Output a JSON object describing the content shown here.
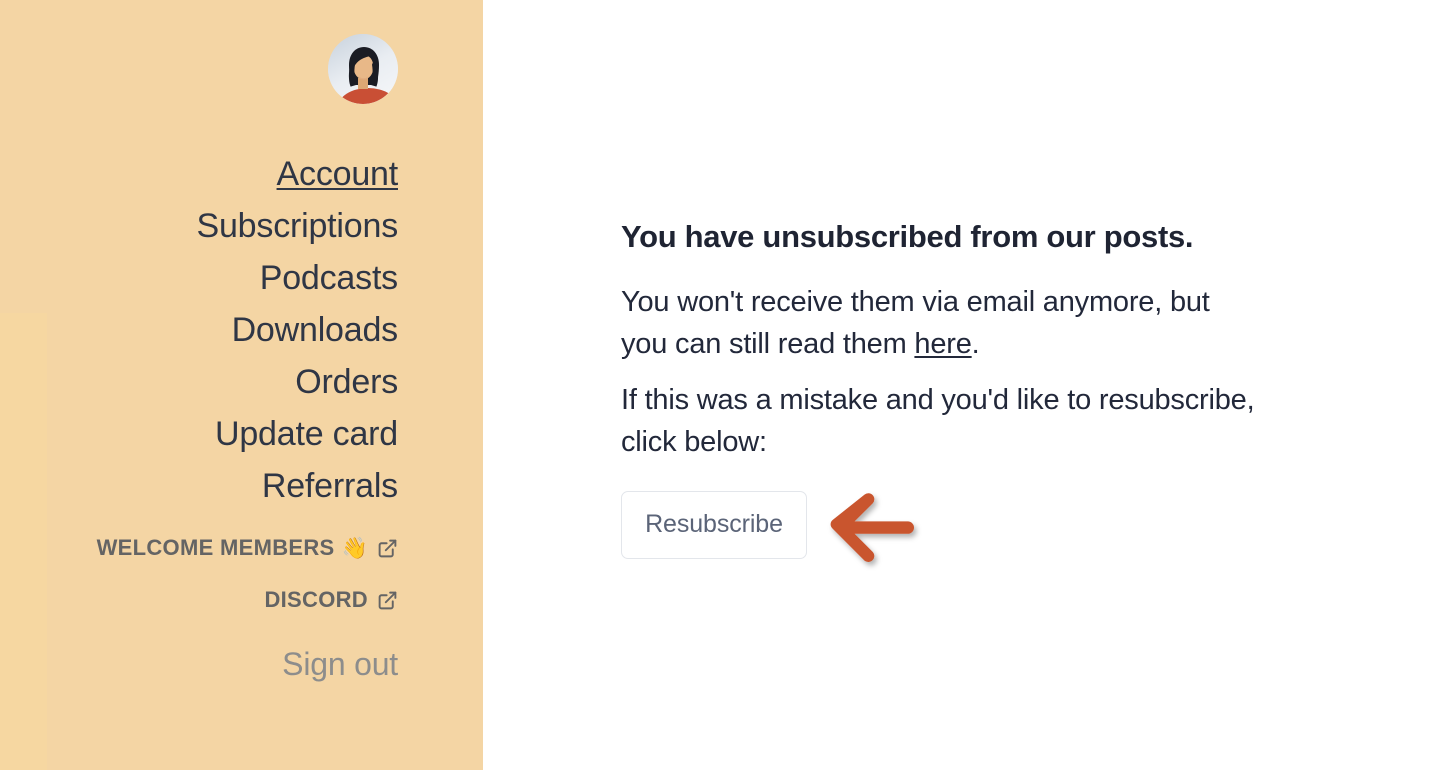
{
  "theme": {
    "sidebar_bg": "#f4d5a4",
    "sidebar_edge": "#f6d7a1",
    "main_bg": "#ffffff",
    "nav_text": "#2f3645",
    "ext_link_text": "#646464",
    "signout_text": "#8d8d8c",
    "headline_text": "#1f2433",
    "body_text": "#22283a",
    "button_border": "#e3e6eb",
    "button_text": "#5b6478",
    "annotation_arrow": "#c9552e"
  },
  "sidebar": {
    "avatar": {
      "icon": "user-avatar-illustration",
      "alt": "Member profile picture",
      "hair_color": "#1a1c24",
      "skin_color": "#e8b888",
      "shirt_color": "#c94f35"
    },
    "nav_items": [
      {
        "label": "Account",
        "active": true
      },
      {
        "label": "Subscriptions",
        "active": false
      },
      {
        "label": "Podcasts",
        "active": false
      },
      {
        "label": "Downloads",
        "active": false
      },
      {
        "label": "Orders",
        "active": false
      },
      {
        "label": "Update card",
        "active": false
      },
      {
        "label": "Referrals",
        "active": false
      }
    ],
    "external_links": [
      {
        "label": "WELCOME MEMBERS",
        "emoji": "👋",
        "icon": "external-link-icon"
      },
      {
        "label": "DISCORD",
        "emoji": "",
        "icon": "external-link-icon"
      }
    ],
    "signout_label": "Sign out"
  },
  "main": {
    "headline": "You have unsubscribed from our posts.",
    "paragraph_one": {
      "before_link": "You won't receive them via email anymore, but you can still read them ",
      "link_text": "here",
      "after_link": "."
    },
    "paragraph_two": "If this was a mistake and you'd like to resubscribe, click below:",
    "resubscribe_button_label": "Resubscribe",
    "annotation": {
      "icon": "left-pointing-arrow-annotation",
      "direction": "left",
      "points_at": "Resubscribe"
    }
  }
}
